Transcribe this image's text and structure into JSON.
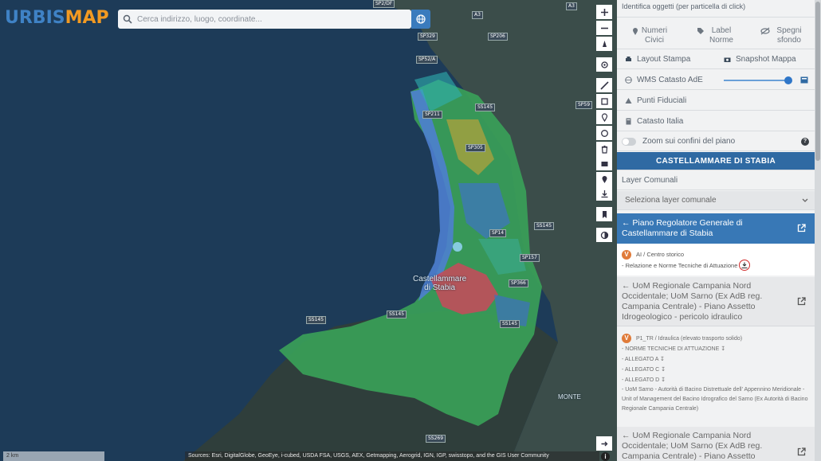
{
  "app": {
    "logo_part1": "URBIS",
    "logo_part2": "MAP"
  },
  "search": {
    "placeholder": "Cerca indirizzo, luogo, coordinate..."
  },
  "map": {
    "road_labels": [
      "SP2/DF",
      "A3",
      "A3",
      "SP329",
      "SP206",
      "SP52/A",
      "SS145",
      "SP211",
      "SP59",
      "SP305",
      "SP14",
      "SS145",
      "SP157",
      "SP366",
      "SS145",
      "SS145",
      "SS145",
      "SS269"
    ],
    "town_label_1": "Castellammare",
    "town_label_2": "di Stabia",
    "place_label_monte": "MONTE"
  },
  "panel": {
    "top_partial": "Identifica oggetti (per particella di click)",
    "tools_row": [
      {
        "icon": "pin-icon",
        "label1": "Numeri",
        "label2": "Civici"
      },
      {
        "icon": "tag-icon",
        "label1": "Label",
        "label2": "Norme"
      },
      {
        "icon": "eye-off-icon",
        "label1": "Spegni",
        "label2": "sfondo"
      }
    ],
    "layout_stampa": "Layout Stampa",
    "snapshot_mappa": "Snapshot Mappa",
    "wms_catasto": "WMS Catasto AdE",
    "wms_opacity": 0.95,
    "punti_fiduciali": "Punti Fiduciali",
    "catasto_italia": "Catasto Italia",
    "zoom_confini": "Zoom sui confini del piano",
    "comune_header": "CASTELLAMMARE DI STABIA",
    "layer_comunali": "Layer Comunali",
    "select_layer": "Seleziona layer comunale",
    "pgr_title": "← Piano Regolatore Generale di Castellammare di Stabia",
    "pgr_badge": "V",
    "pgr_zone": "AI / Centro storico",
    "pgr_doc": "- Relazione e Norme Tecniche di Attuazione",
    "uom1_title": "← UoM Regionale Campania Nord Occidentale; UoM Sarno (Ex AdB reg. Campania Centrale) - Piano Assetto Idrogeologico - pericolo idraulico",
    "uom1_badge": "V",
    "uom1_zone": "P1_TR / Idraulica (elevato trasporto solido)",
    "uom1_items": [
      "- NORME TECNICHE DI ATTUAZIONE",
      "- ALLEGATO A",
      "- ALLEGATO C",
      "- ALLEGATO D"
    ],
    "uom1_note": "- UoM Sarno - Autorità di Bacino Distrettuale dell' Appennino Meridionale - Unit of Management del Bacino Idrografico del Sarno (Ex Autorità di Bacino Regionale Campania Centrale)",
    "uom2_title": "← UoM Regionale Campania Nord Occidentale; UoM Sarno (Ex AdB reg. Campania Centrale) - Piano Assetto"
  },
  "footer": {
    "attribution": "Sources: Esri, DigitalGlobe, GeoEye, i-cubed, USDA FSA, USGS, AEX, Getmapping, Aerogrid, IGN, IGP, swisstopo, and the GIS User Community",
    "scale": "2 km",
    "info": "i"
  },
  "colors": {
    "accent": "#2f6aa3",
    "pgr_blue": "#3878b6",
    "badge": "#e07b3a"
  }
}
